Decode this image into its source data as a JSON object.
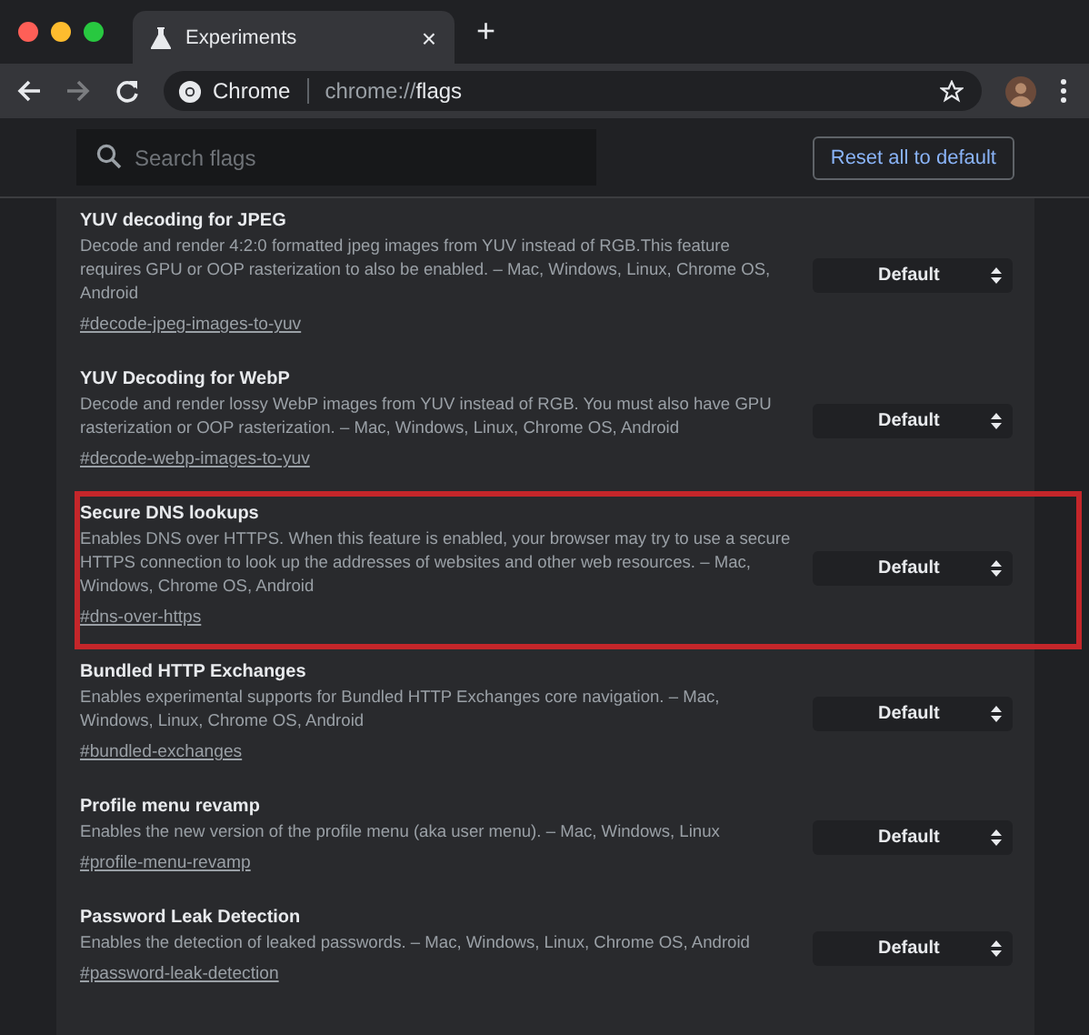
{
  "tab": {
    "title": "Experiments",
    "close": "×",
    "new_tab": "+"
  },
  "toolbar": {
    "site_name": "Chrome",
    "url_scheme": "chrome://",
    "url_path": "flags"
  },
  "header": {
    "search": {
      "placeholder": "Search flags"
    },
    "reset_button": "Reset all to default"
  },
  "flags": [
    {
      "title": "YUV decoding for JPEG",
      "description": "Decode and render 4:2:0 formatted jpeg images from YUV instead of RGB.This feature requires GPU or OOP rasterization to also be enabled. – Mac, Windows, Linux, Chrome OS, Android",
      "link": "#decode-jpeg-images-to-yuv",
      "value": "Default",
      "highlighted": false
    },
    {
      "title": "YUV Decoding for WebP",
      "description": "Decode and render lossy WebP images from YUV instead of RGB. You must also have GPU rasterization or OOP rasterization. – Mac, Windows, Linux, Chrome OS, Android",
      "link": "#decode-webp-images-to-yuv",
      "value": "Default",
      "highlighted": false
    },
    {
      "title": "Secure DNS lookups",
      "description": "Enables DNS over HTTPS. When this feature is enabled, your browser may try to use a secure HTTPS connection to look up the addresses of websites and other web resources. – Mac, Windows, Chrome OS, Android",
      "link": "#dns-over-https",
      "value": "Default",
      "highlighted": true
    },
    {
      "title": "Bundled HTTP Exchanges",
      "description": "Enables experimental supports for Bundled HTTP Exchanges core navigation. – Mac, Windows, Linux, Chrome OS, Android",
      "link": "#bundled-exchanges",
      "value": "Default",
      "highlighted": false
    },
    {
      "title": "Profile menu revamp",
      "description": "Enables the new version of the profile menu (aka user menu). – Mac, Windows, Linux",
      "link": "#profile-menu-revamp",
      "value": "Default",
      "highlighted": false
    },
    {
      "title": "Password Leak Detection",
      "description": "Enables the detection of leaked passwords. – Mac, Windows, Linux, Chrome OS, Android",
      "link": "#password-leak-detection",
      "value": "Default",
      "highlighted": false
    }
  ]
}
